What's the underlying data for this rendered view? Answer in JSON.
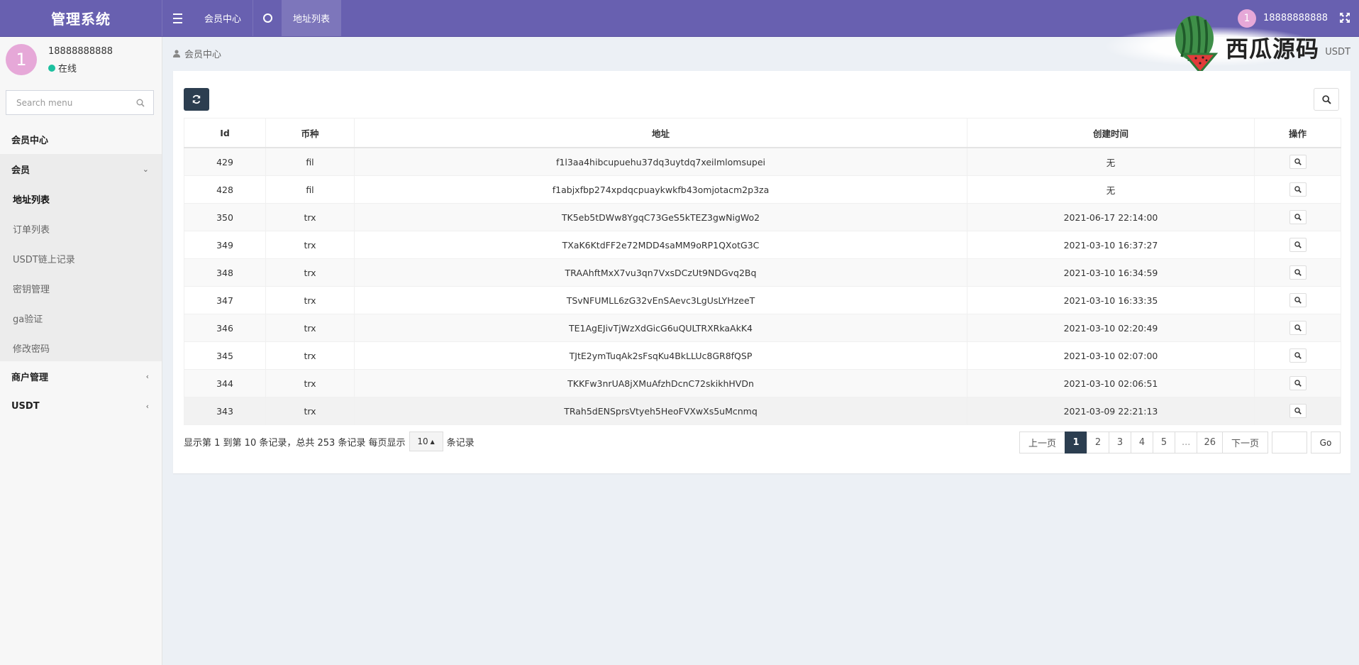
{
  "brand": "管理系统",
  "topnav": {
    "items": [
      {
        "label": "会员中心"
      },
      {
        "label": "地址列表"
      }
    ],
    "user": "18888888888",
    "avatar_initial": "1"
  },
  "watermark": "西瓜源码",
  "sidebar": {
    "user": {
      "avatar_initial": "1",
      "name": "18888888888",
      "status": "在线"
    },
    "search_placeholder": "Search menu",
    "sections": [
      {
        "label": "会员中心"
      },
      {
        "label": "会员"
      },
      {
        "label": "商户管理"
      },
      {
        "label": "USDT"
      }
    ],
    "sub_items": [
      {
        "label": "地址列表"
      },
      {
        "label": "订单列表"
      },
      {
        "label": "USDT链上记录"
      },
      {
        "label": "密钥管理"
      },
      {
        "label": "ga验证"
      },
      {
        "label": "修改密码"
      }
    ]
  },
  "breadcrumb": {
    "label": "会员中心",
    "right": "USDT"
  },
  "table": {
    "columns": [
      "Id",
      "币种",
      "地址",
      "创建时间",
      "操作"
    ],
    "rows": [
      {
        "id": "429",
        "coin": "fil",
        "address": "f1l3aa4hibcupuehu37dq3uytdq7xeilmlomsupei",
        "time": "无"
      },
      {
        "id": "428",
        "coin": "fil",
        "address": "f1abjxfbp274xpdqcpuaykwkfb43omjotacm2p3za",
        "time": "无"
      },
      {
        "id": "350",
        "coin": "trx",
        "address": "TK5eb5tDWw8YgqC73GeS5kTEZ3gwNigWo2",
        "time": "2021-06-17 22:14:00"
      },
      {
        "id": "349",
        "coin": "trx",
        "address": "TXaK6KtdFF2e72MDD4saMM9oRP1QXotG3C",
        "time": "2021-03-10 16:37:27"
      },
      {
        "id": "348",
        "coin": "trx",
        "address": "TRAAhftMxX7vu3qn7VxsDCzUt9NDGvq2Bq",
        "time": "2021-03-10 16:34:59"
      },
      {
        "id": "347",
        "coin": "trx",
        "address": "TSvNFUMLL6zG32vEnSAevc3LgUsLYHzeeT",
        "time": "2021-03-10 16:33:35"
      },
      {
        "id": "346",
        "coin": "trx",
        "address": "TE1AgEJivTjWzXdGicG6uQULTRXRkaAkK4",
        "time": "2021-03-10 02:20:49"
      },
      {
        "id": "345",
        "coin": "trx",
        "address": "TJtE2ymTuqAk2sFsqKu4BkLLUc8GR8fQSP",
        "time": "2021-03-10 02:07:00"
      },
      {
        "id": "344",
        "coin": "trx",
        "address": "TKKFw3nrUA8jXMuAfzhDcnC72skikhHVDn",
        "time": "2021-03-10 02:06:51"
      },
      {
        "id": "343",
        "coin": "trx",
        "address": "TRah5dENSprsVtyeh5HeoFVXwXs5uMcnmq",
        "time": "2021-03-09 22:21:13"
      }
    ]
  },
  "footer": {
    "info_prefix": "显示第 1 到第 10 条记录，总共 253 条记录 每页显示",
    "page_size": "10",
    "info_suffix": "条记录"
  },
  "pagination": {
    "prev": "上一页",
    "pages": [
      "1",
      "2",
      "3",
      "4",
      "5",
      "...",
      "26"
    ],
    "current": "1",
    "next": "下一页",
    "go": "Go"
  },
  "colors": {
    "topbar": "#6860b0",
    "dark_button": "#2c3e50",
    "online_dot": "#1cc09f",
    "avatar": "#e6a8d8"
  }
}
